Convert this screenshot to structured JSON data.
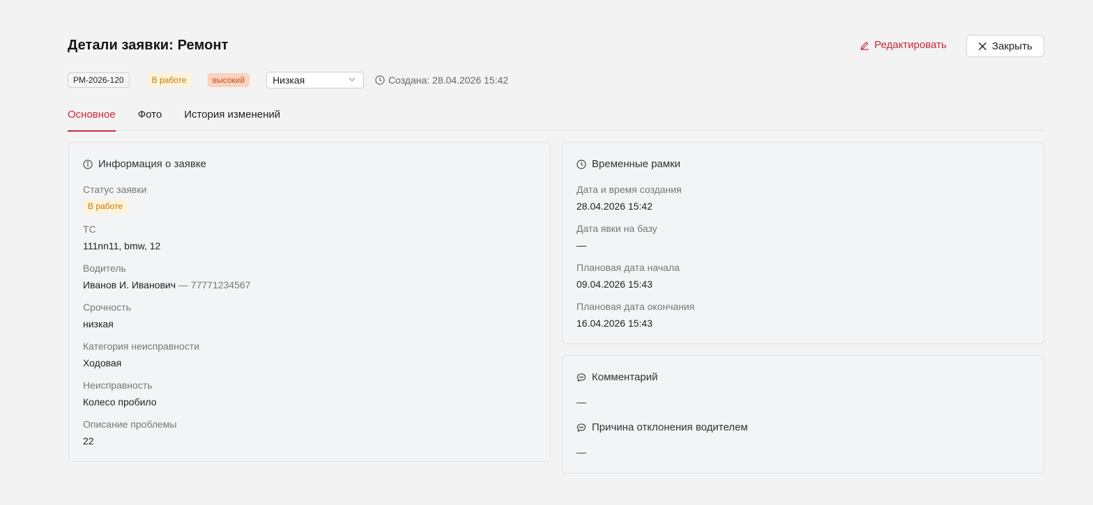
{
  "header": {
    "title": "Детали заявки: Ремонт",
    "edit_label": "Редактировать",
    "close_label": "Закрыть"
  },
  "meta": {
    "id": "РМ-2026-120",
    "status": "В работе",
    "priority": "высокий",
    "urgency_select_value": "Низкая",
    "created": "Создана: 28.04.2026 15:42"
  },
  "tabs": [
    {
      "label": "Основное",
      "active": true
    },
    {
      "label": "Фото",
      "active": false
    },
    {
      "label": "История изменений",
      "active": false
    }
  ],
  "info_card": {
    "title": "Информация о заявке",
    "icon": "info-icon",
    "status_label": "Статус заявки",
    "status_value": "В работе",
    "vehicle_label": "ТС",
    "vehicle_value": "111nn11, bmw, 12",
    "driver_label": "Водитель",
    "driver_name": "Иванов И. Иванович",
    "driver_phone": " — 77771234567",
    "urgency_label": "Срочность",
    "urgency_value": "низкая",
    "category_label": "Категория неисправности",
    "category_value": "Ходовая",
    "fault_label": "Неисправность",
    "fault_value": "Колесо пробило",
    "description_label": "Описание проблемы",
    "description_value": "22"
  },
  "time_card": {
    "title": "Временные рамки",
    "icon": "clock-icon",
    "created_label": "Дата и время создания",
    "created_value": "28.04.2026 15:42",
    "arrival_label": "Дата явки на базу",
    "arrival_value": "—",
    "plan_start_label": "Плановая дата начала",
    "plan_start_value": "09.04.2026 15:43",
    "plan_end_label": "Плановая дата окончания",
    "plan_end_value": "16.04.2026 15:43"
  },
  "comment_card": {
    "comment_title": "Комментарий",
    "comment_value": "—",
    "reject_title": "Причина отклонения водителем",
    "reject_value": "—",
    "icon": "chat-icon"
  },
  "colors": {
    "accent": "#c8283a",
    "status_bg": "#fdf3d8",
    "status_fg": "#c27c0e",
    "priority_bg": "#fad2bd",
    "priority_fg": "#c15423"
  }
}
